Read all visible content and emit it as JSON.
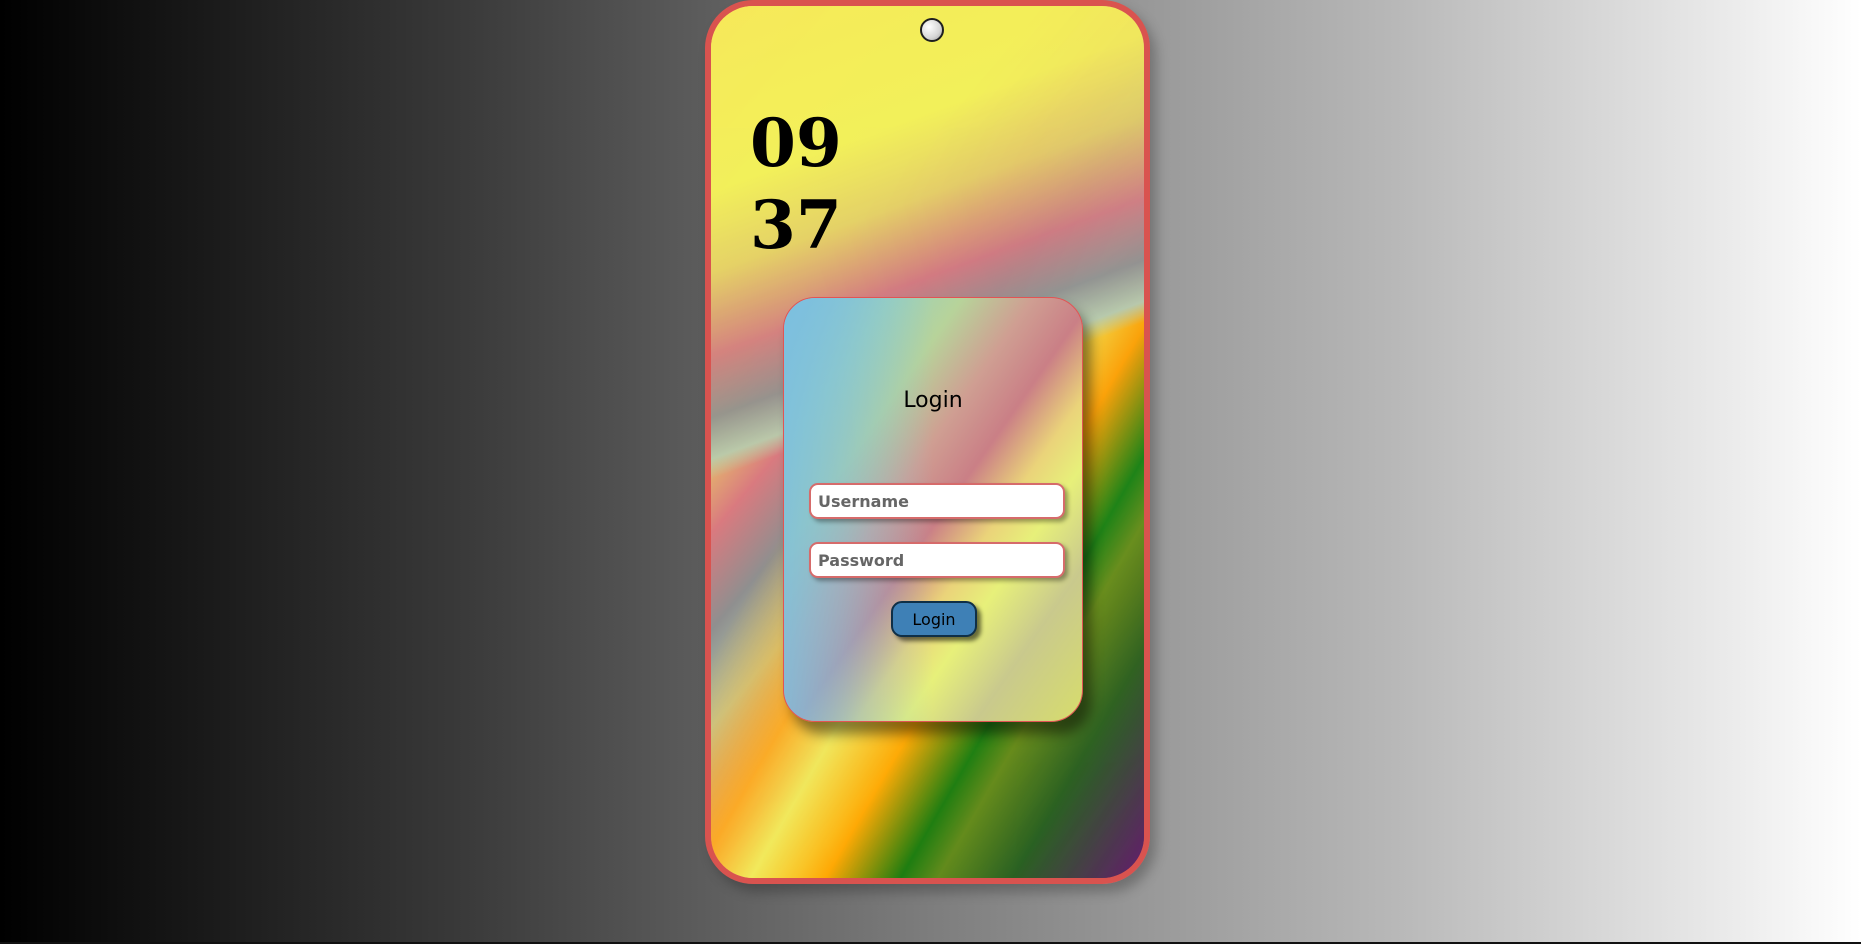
{
  "clock": {
    "hours": "09",
    "minutes": "37"
  },
  "login_card": {
    "title": "Login",
    "username_placeholder": "Username",
    "password_placeholder": "Password",
    "button_label": "Login"
  },
  "colors": {
    "phone_border": "#d9534f",
    "button_background": "#3e80b6",
    "input_border": "#d66b6b"
  },
  "icons": {
    "camera": "camera-icon"
  }
}
